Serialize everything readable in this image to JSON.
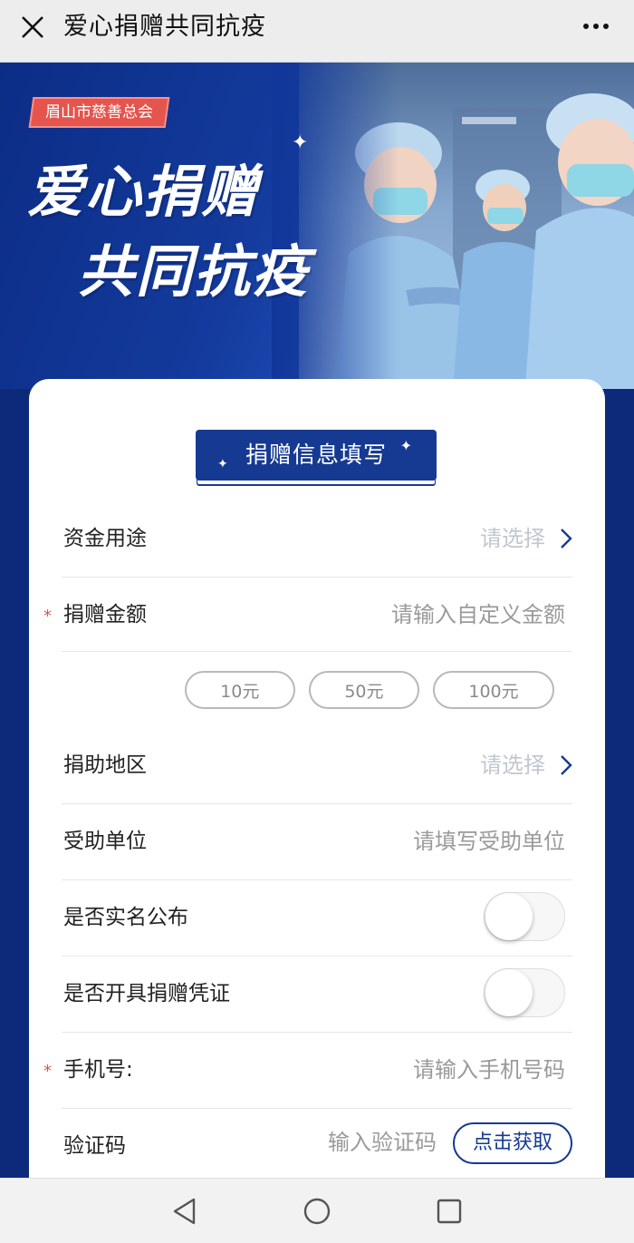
{
  "topbar": {
    "title": "爱心捐赠共同抗疫"
  },
  "banner": {
    "org": "眉山市慈善总会",
    "line1": "爱心捐赠",
    "line2": "共同抗疫"
  },
  "form": {
    "section_title": "捐赠信息填写",
    "fund_use": {
      "label": "资金用途",
      "value": "请选择"
    },
    "amount": {
      "required_mark": "*",
      "label": "捐赠金额",
      "placeholder": "请输入自定义金额"
    },
    "amount_options": [
      "10元",
      "50元",
      "100元"
    ],
    "region": {
      "label": "捐助地区",
      "value": "请选择"
    },
    "recipient": {
      "label": "受助单位",
      "placeholder": "请填写受助单位"
    },
    "real_name": {
      "label": "是否实名公布",
      "on": false
    },
    "receipt": {
      "label": "是否开具捐赠凭证",
      "on": false
    },
    "phone": {
      "required_mark": "*",
      "label": "手机号:",
      "placeholder": "请输入手机号码"
    },
    "code": {
      "label": "验证码",
      "placeholder": "输入验证码",
      "button": "点击获取"
    }
  },
  "icons": {
    "close": "close-icon",
    "more": "more-icon",
    "chevron": "chevron-right-icon",
    "nav_back": "back-triangle-icon",
    "nav_home": "home-circle-icon",
    "nav_recents": "recents-square-icon"
  },
  "colors": {
    "brand_blue": "#163a92",
    "badge_red": "#e5544d",
    "required_red": "#e3514a"
  }
}
